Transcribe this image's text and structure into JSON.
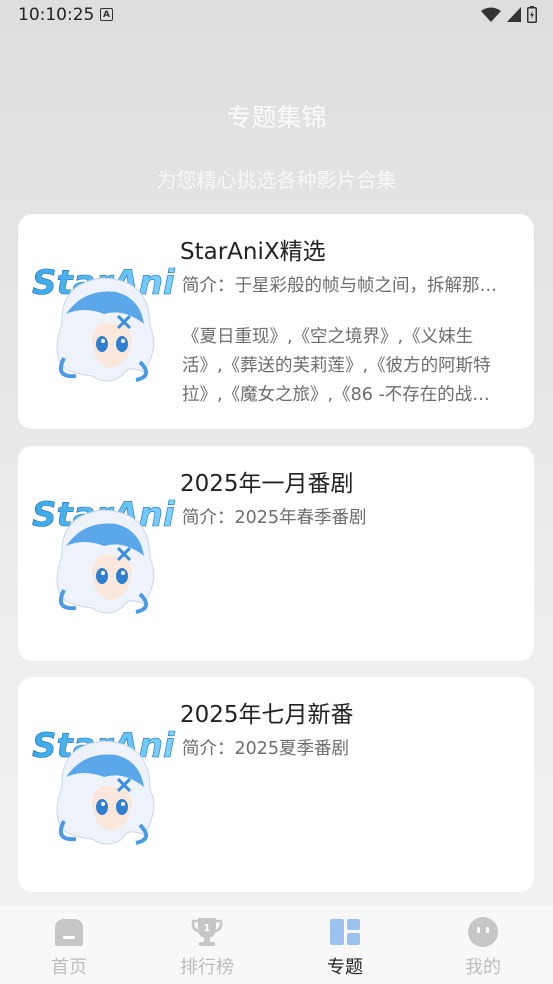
{
  "status_bar": {
    "time": "10:10:25",
    "notification_icon": "A"
  },
  "header": {
    "title": "专题集锦",
    "subtitle": "为您精心挑选各种影片合集"
  },
  "cards": [
    {
      "title": "StarAniX精选",
      "desc_line": "简介：于星彩般的帧与帧之间，拆解那…",
      "desc_para": "《夏日重现》,《空之境界》,《义妹生活》,《葬送的芙莉莲》,《彼方的阿斯特拉》,《魔女之旅》,《86 -不存在的战…"
    },
    {
      "title": "2025年一月番剧",
      "desc_line": "简介：2025年春季番剧",
      "desc_para": ""
    },
    {
      "title": "2025年七月新番",
      "desc_line": "简介：2025夏季番剧",
      "desc_para": ""
    }
  ],
  "logo_text": "StarAni",
  "tabs": [
    {
      "label": "首页",
      "icon": "home-icon"
    },
    {
      "label": "排行榜",
      "icon": "trophy-icon"
    },
    {
      "label": "专题",
      "icon": "topics-icon"
    },
    {
      "label": "我的",
      "icon": "profile-icon"
    }
  ],
  "active_tab": "专题",
  "colors": {
    "active_icon": "#9cc2f0",
    "inactive_icon": "#c6c6c6",
    "active_label": "#222222",
    "inactive_label": "#bdbdbd"
  }
}
